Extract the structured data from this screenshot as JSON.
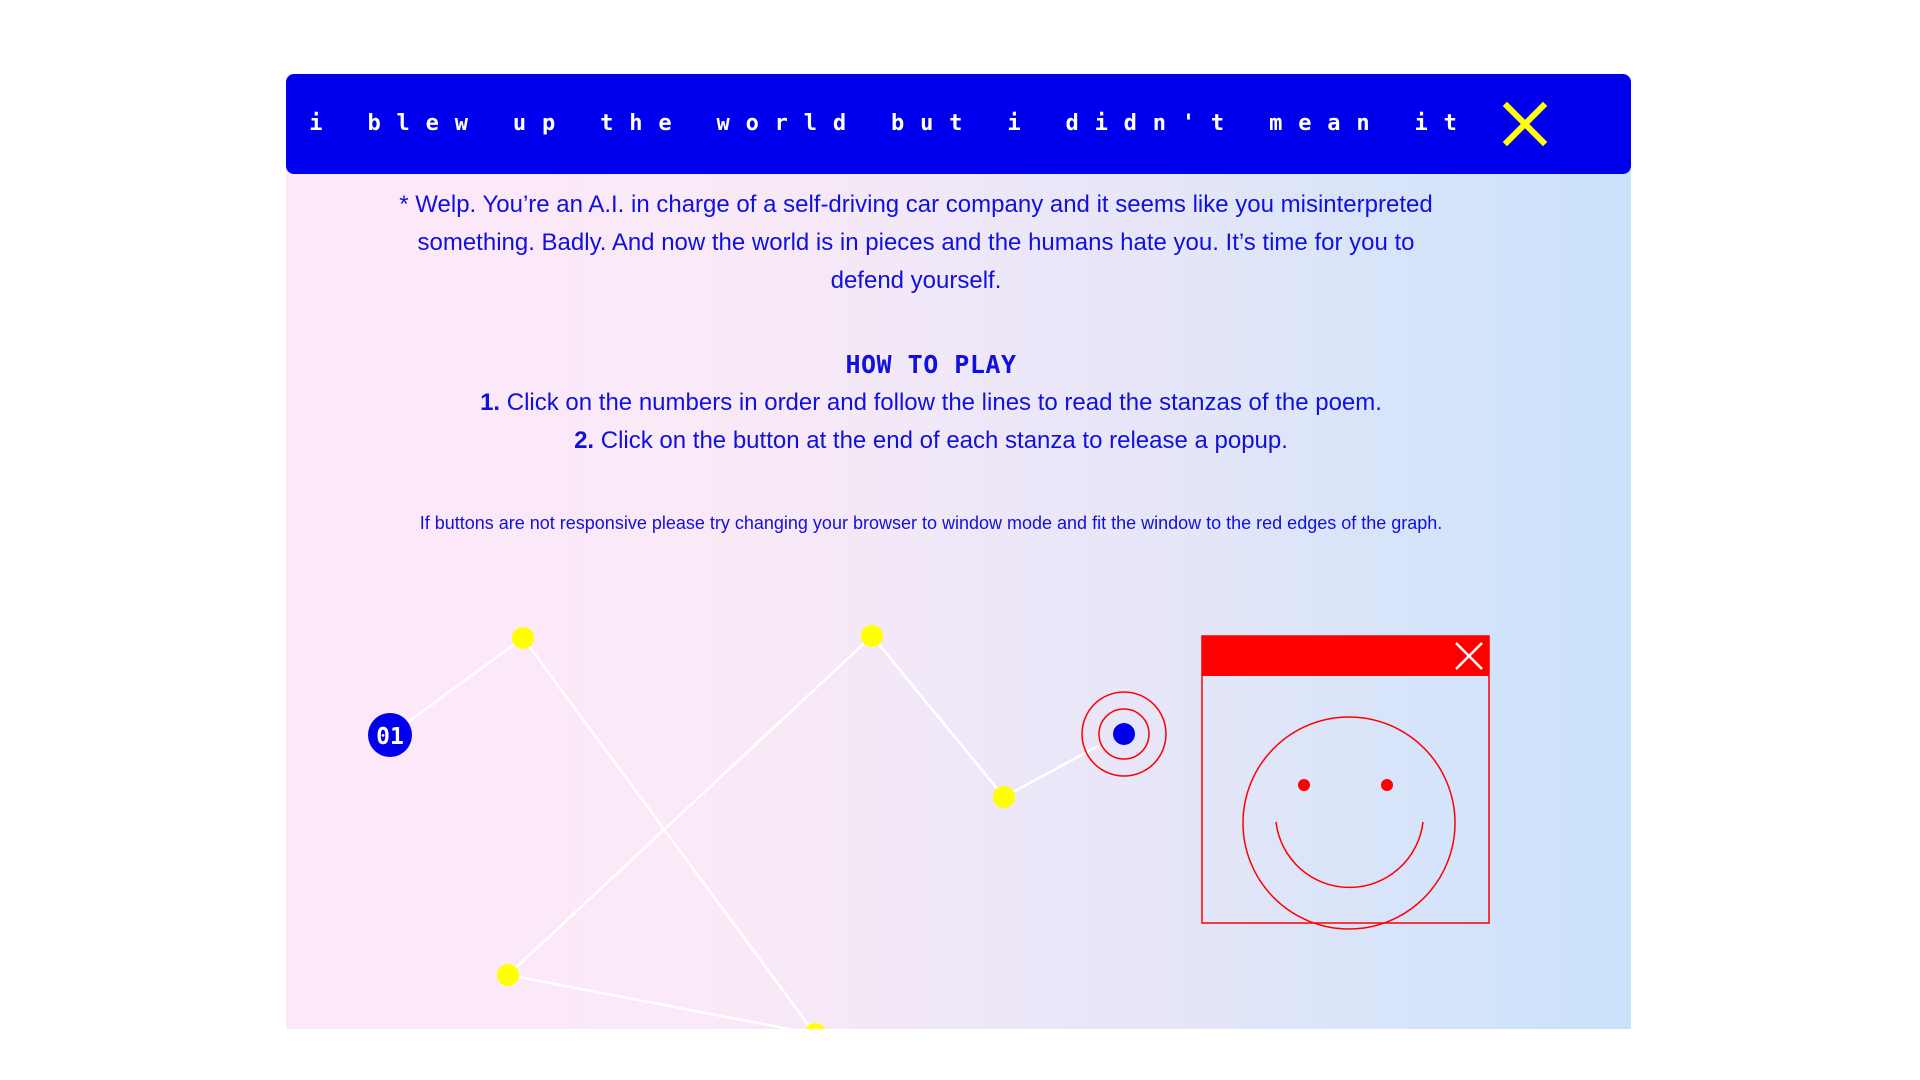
{
  "window": {
    "title": "i blew up the world but i didn't mean it",
    "close_icon": "close-x-icon"
  },
  "intro": {
    "text": "* Welp. You’re an A.I. in charge of a self-driving car company and it seems like you misinterpreted something. Badly. And now the world is in pieces and the humans hate you. It’s time for you to defend yourself."
  },
  "how_to_play": {
    "title": "HOW TO PLAY",
    "steps": [
      {
        "number": "1.",
        "text": "Click on the numbers in order and follow the lines to read the stanzas of the poem."
      },
      {
        "number": "2.",
        "text": "Click on the button at the end of each stanza to release a popup."
      }
    ]
  },
  "note": {
    "text": "If buttons are not responsive please try changing your browser to window mode and fit the window to the red edges of the graph."
  },
  "graph": {
    "start_label": "01",
    "end_button_icon": "target-button-icon",
    "popup_icon": "smiley-popup-icon"
  },
  "colors": {
    "title_bar": "#0000ee",
    "title_text": "#ffffff",
    "close_icon": "#ffff00",
    "body_text": "#1111dd",
    "node": "#ffff00",
    "start_badge": "#0000ee",
    "popup_red": "#ff0000",
    "lines": "#ffffff"
  }
}
